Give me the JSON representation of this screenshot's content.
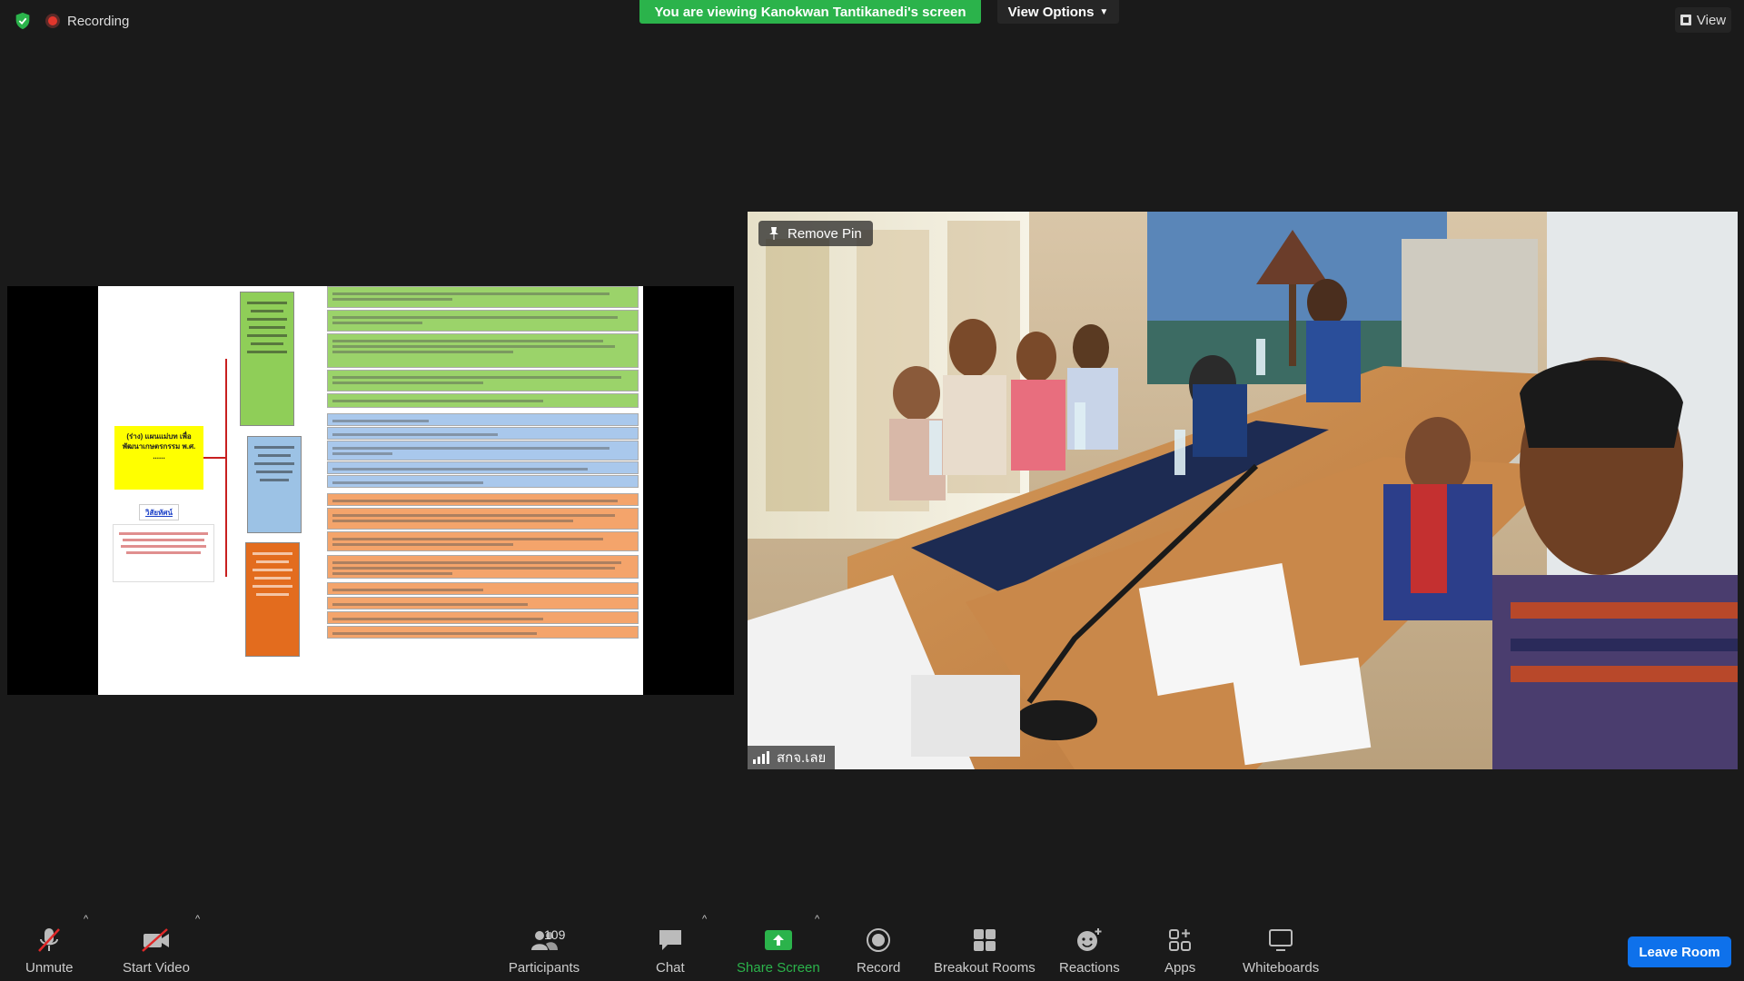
{
  "top": {
    "recording_label": "Recording",
    "banner_text": "You are viewing Kanokwan Tantikanedi's screen",
    "view_options_label": "View Options",
    "view_label": "View"
  },
  "slide": {
    "plan_title": "(ร่าง) แผนแม่บท เพื่อพัฒนาเกษตรกรรม พ.ศ. ......",
    "vision_label": "วิสัยทัศน์"
  },
  "camera": {
    "remove_pin_label": "Remove Pin",
    "participant_name": "สกจ.เลย"
  },
  "toolbar": {
    "unmute_label": "Unmute",
    "start_video_label": "Start Video",
    "participants_label": "Participants",
    "participants_count": "109",
    "chat_label": "Chat",
    "share_screen_label": "Share Screen",
    "record_label": "Record",
    "breakout_rooms_label": "Breakout Rooms",
    "reactions_label": "Reactions",
    "apps_label": "Apps",
    "whiteboards_label": "Whiteboards",
    "leave_label": "Leave Room"
  },
  "colors": {
    "banner": "#2bb34b",
    "leave": "#0e71eb",
    "share_icon": "#2bb34b",
    "muted_red": "#e02828"
  }
}
